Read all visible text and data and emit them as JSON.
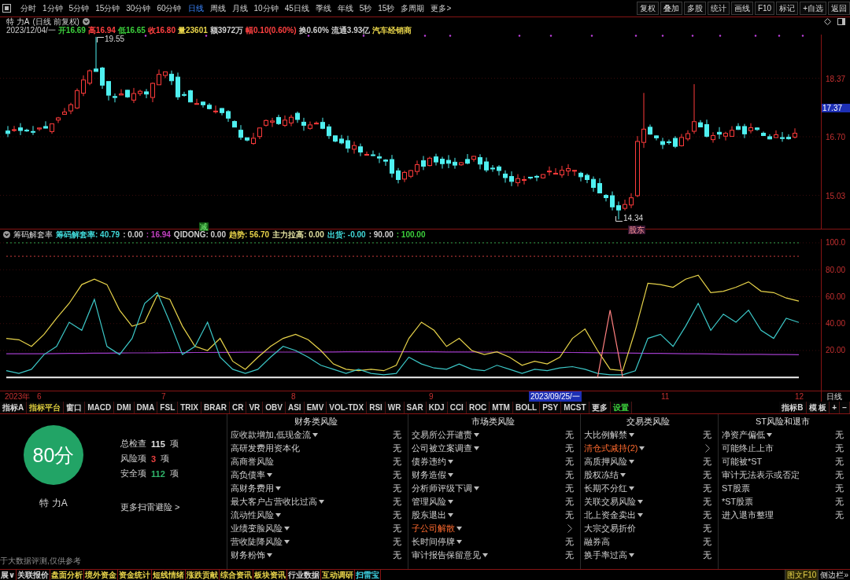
{
  "toolbar": {
    "periods": [
      {
        "label": "分时",
        "selected": false
      },
      {
        "label": "1分钟",
        "selected": false
      },
      {
        "label": "5分钟",
        "selected": false
      },
      {
        "label": "15分钟",
        "selected": false
      },
      {
        "label": "30分钟",
        "selected": false
      },
      {
        "label": "60分钟",
        "selected": false
      },
      {
        "label": "日线",
        "selected": true
      },
      {
        "label": "周线",
        "selected": false
      },
      {
        "label": "月线",
        "selected": false
      },
      {
        "label": "10分钟",
        "selected": false
      },
      {
        "label": "45日线",
        "selected": false
      },
      {
        "label": "季线",
        "selected": false
      },
      {
        "label": "年线",
        "selected": false
      },
      {
        "label": "5秒",
        "selected": false
      },
      {
        "label": "15秒",
        "selected": false
      },
      {
        "label": "多周期",
        "selected": false
      },
      {
        "label": "更多>",
        "selected": false
      }
    ],
    "actions": [
      "复权",
      "叠加",
      "多股",
      "统计",
      "画线",
      "F10",
      "标记",
      "+自选",
      "返回"
    ]
  },
  "chart_header": {
    "stock": "特 力A",
    "mode": "(日线 前复权)",
    "date": "2023/12/04/一",
    "quote": [
      {
        "text": "开16.69",
        "color": "#3ccf3c"
      },
      {
        "text": "高16.94",
        "color": "#ff4040"
      },
      {
        "text": "低16.65",
        "color": "#3ccf3c"
      },
      {
        "text": "收16.80",
        "color": "#ff4040"
      },
      {
        "text": "量23601",
        "color": "#e8d44a"
      },
      {
        "text": "额3972万",
        "color": "#d0d0d0"
      },
      {
        "text": "幅0.10(0.60%)",
        "color": "#ff4040"
      },
      {
        "text": "换0.60%",
        "color": "#d0d0d0"
      },
      {
        "text": "流通3.93亿",
        "color": "#d0d0d0"
      },
      {
        "text": "汽车经销商",
        "color": "#e8d44a"
      }
    ]
  },
  "price_chart": {
    "axis": [
      {
        "text": "18.37",
        "current": false
      },
      {
        "text": "17.37",
        "current": true
      },
      {
        "text": "16.70",
        "current": false
      },
      {
        "text": "15.03",
        "current": false
      }
    ],
    "high": "19.55",
    "low": "14.34",
    "signals": [
      {
        "text": "减",
        "kind": "reduce"
      },
      {
        "text": "股东",
        "kind": "holder"
      }
    ]
  },
  "indicator": {
    "name": "筹码解套率",
    "readouts": [
      {
        "text": "筹码解套率: 40.79",
        "color": "#40d8d8"
      },
      {
        "text": ": 0.00",
        "color": "#d0d0d0"
      },
      {
        "text": ": 16.94",
        "color": "#c040c0"
      },
      {
        "text": "QIDONG: 0.00",
        "color": "#d0d0d0"
      },
      {
        "text": "趋势: 56.70",
        "color": "#e8d44a"
      },
      {
        "text": "主力拉高: 0.00",
        "color": "#e0e0a0"
      },
      {
        "text": "出货: -0.00",
        "color": "#40d8d8"
      },
      {
        "text": ": 90.00",
        "color": "#d0d0d0"
      },
      {
        "text": ": 100.00",
        "color": "#3ccf3c"
      }
    ],
    "chart_data": {
      "type": "line",
      "grid": true,
      "ylim": [
        -9.8,
        102.9
      ],
      "yticks": [
        {
          "value": 20,
          "label": "20.00"
        },
        {
          "value": 40,
          "label": "40.00"
        },
        {
          "value": 60,
          "label": "60.00"
        },
        {
          "value": 80,
          "label": "80.00"
        },
        {
          "value": 100,
          "label": "100.0"
        }
      ],
      "ref_lines": [
        {
          "axis": "y",
          "value": 100,
          "color": "#2fa84f"
        },
        {
          "axis": "y",
          "value": 90,
          "color": "#c83c3c"
        }
      ],
      "series": [
        {
          "color": "#a03cc8",
          "values": [
            17.5,
            17.5,
            17.6,
            17.6,
            17.7,
            17.8,
            17.9,
            18,
            18,
            18.1,
            18.2,
            18.2,
            18.3,
            18.4,
            18.4,
            18.5,
            18.5,
            18.6,
            18.6,
            18.7,
            18.7,
            18.8,
            18.8,
            18.8,
            18.9,
            18.9,
            18.9,
            19,
            19,
            19,
            19,
            19,
            19,
            19,
            19,
            18.9,
            18.9,
            18.9,
            18.8,
            18.8,
            18.8,
            18.7,
            18.7,
            18.6,
            18.6,
            18.5,
            18.4,
            18.3,
            18.2,
            18.1,
            18,
            17.9,
            17.8,
            17.7,
            17.6,
            17.5,
            17.4,
            17.3,
            17.2,
            17.2,
            17.1,
            17,
            17,
            16.9
          ]
        },
        {
          "color": "#f0f0f0",
          "values": [
            0,
            0,
            0,
            0,
            0,
            0,
            0,
            0,
            0,
            0,
            0,
            0,
            0,
            0,
            0,
            0,
            0,
            0,
            0,
            0,
            0,
            0,
            0,
            0,
            0,
            0,
            0,
            0,
            0,
            0,
            0,
            0,
            0,
            0,
            0,
            0,
            0,
            0,
            0,
            0,
            0,
            0,
            0,
            0,
            0,
            0,
            0,
            0,
            0,
            0,
            0,
            0,
            0,
            0,
            0,
            0,
            0,
            0,
            0,
            0,
            0,
            0,
            0,
            0
          ]
        },
        {
          "color": "#e8d44a",
          "values": [
            29,
            28,
            23,
            32,
            44,
            55,
            69,
            73,
            69,
            50,
            38,
            41,
            61,
            58,
            38,
            23,
            20,
            29,
            12,
            6,
            15,
            23,
            29,
            32,
            28,
            20,
            10,
            6,
            5,
            6,
            5,
            9,
            29,
            41,
            35,
            23,
            29,
            20,
            17,
            19,
            15,
            9,
            12,
            10,
            15,
            29,
            36,
            20,
            6,
            5,
            35,
            70,
            69,
            67,
            73,
            76,
            63,
            64,
            67,
            71,
            64,
            63,
            59,
            56.7
          ]
        },
        {
          "color": "#3cc8c8",
          "values": [
            5,
            3,
            6,
            17,
            23,
            41,
            35,
            58,
            23,
            17,
            29,
            55,
            63,
            41,
            17,
            23,
            41,
            15,
            6,
            3,
            6,
            15,
            23,
            20,
            15,
            9,
            6,
            3,
            6,
            3,
            2,
            3,
            15,
            10,
            7,
            6,
            10,
            6,
            5,
            9,
            6,
            3,
            6,
            5,
            7,
            8,
            6,
            3,
            2,
            2,
            5,
            29,
            32,
            23,
            38,
            55,
            35,
            47,
            41,
            50,
            35,
            29,
            44,
            40.8
          ]
        },
        {
          "color": "#ff8080",
          "values": [
            null,
            null,
            null,
            null,
            null,
            null,
            null,
            null,
            null,
            null,
            null,
            null,
            null,
            null,
            null,
            null,
            null,
            null,
            null,
            null,
            null,
            null,
            null,
            null,
            null,
            null,
            null,
            null,
            null,
            null,
            null,
            null,
            null,
            null,
            null,
            null,
            null,
            null,
            null,
            null,
            null,
            null,
            null,
            null,
            null,
            null,
            null,
            0,
            50,
            0,
            null,
            null,
            null,
            null,
            null,
            null,
            null,
            null,
            null,
            null,
            null,
            null,
            null,
            null
          ]
        }
      ]
    }
  },
  "date_axis": {
    "labels": [
      {
        "text": "2023年",
        "kind": "year"
      },
      {
        "text": "6",
        "kind": "month"
      },
      {
        "text": "7",
        "kind": "month"
      },
      {
        "text": "8",
        "kind": "month"
      },
      {
        "text": "9",
        "kind": "month"
      },
      {
        "text": "2023/09/25/一",
        "kind": "cursor"
      },
      {
        "text": "11",
        "kind": "month"
      },
      {
        "text": "12",
        "kind": "month"
      }
    ],
    "period": "日线"
  },
  "indicator_tabs": {
    "left": [
      {
        "label": "指标A",
        "color": "#d8d8d8"
      },
      {
        "label": "指标平台",
        "color": "#d8c83c"
      },
      {
        "label": "窗口",
        "color": "#d8d8d8"
      },
      {
        "label": "MACD",
        "color": "#d8d8d8"
      },
      {
        "label": "DMI",
        "color": "#d8d8d8"
      },
      {
        "label": "DMA",
        "color": "#d8d8d8"
      },
      {
        "label": "FSL",
        "color": "#d8d8d8"
      },
      {
        "label": "TRIX",
        "color": "#d8d8d8"
      },
      {
        "label": "BRAR",
        "color": "#d8d8d8"
      },
      {
        "label": "CR",
        "color": "#d8d8d8"
      },
      {
        "label": "VR",
        "color": "#d8d8d8"
      },
      {
        "label": "OBV",
        "color": "#d8d8d8"
      },
      {
        "label": "ASI",
        "color": "#d8d8d8"
      },
      {
        "label": "EMV",
        "color": "#d8d8d8"
      },
      {
        "label": "VOL-TDX",
        "color": "#d8d8d8"
      },
      {
        "label": "RSI",
        "color": "#d8d8d8"
      },
      {
        "label": "WR",
        "color": "#d8d8d8"
      },
      {
        "label": "SAR",
        "color": "#d8d8d8"
      },
      {
        "label": "KDJ",
        "color": "#d8d8d8"
      },
      {
        "label": "CCI",
        "color": "#d8d8d8"
      },
      {
        "label": "ROC",
        "color": "#d8d8d8"
      },
      {
        "label": "MTM",
        "color": "#d8d8d8"
      },
      {
        "label": "BOLL",
        "color": "#d8d8d8"
      },
      {
        "label": "PSY",
        "color": "#d8d8d8"
      },
      {
        "label": "MCST",
        "color": "#d8d8d8"
      },
      {
        "label": "更多",
        "color": "#d8d8d8"
      },
      {
        "label": "设置",
        "color": "#3ccf3c"
      }
    ],
    "right": [
      "指标B",
      "模 板",
      "+",
      "−"
    ]
  },
  "risk_scan": {
    "score": "80分",
    "stock": "特 力A",
    "stats": [
      {
        "label": "总检查",
        "count": "115",
        "unit": "项",
        "color": "#e0e0e0"
      },
      {
        "label": "风险项",
        "count": "3",
        "unit": "项",
        "color": "#e84040"
      },
      {
        "label": "安全项",
        "count": "112",
        "unit": "项",
        "color": "#2fb46a"
      }
    ],
    "more_link": "更多扫雷避险 >",
    "footnote": "于大数据评测,仅供参考",
    "categories": [
      {
        "title": "财务类风险",
        "items": [
          {
            "label": "应收款增加,低现金流",
            "dropdown": true,
            "flagged": false,
            "result": "无"
          },
          {
            "label": "高研发费用资本化",
            "dropdown": false,
            "flagged": false,
            "result": "无"
          },
          {
            "label": "高商誉风险",
            "dropdown": false,
            "flagged": false,
            "result": "无"
          },
          {
            "label": "高负债率",
            "dropdown": true,
            "flagged": false,
            "result": "无"
          },
          {
            "label": "高财务费用",
            "dropdown": true,
            "flagged": false,
            "result": "无"
          },
          {
            "label": "最大客户占营收比过高",
            "dropdown": true,
            "flagged": false,
            "result": "无"
          },
          {
            "label": "流动性风险",
            "dropdown": true,
            "flagged": false,
            "result": "无"
          },
          {
            "label": "业绩变脸风险",
            "dropdown": true,
            "flagged": false,
            "result": "无"
          },
          {
            "label": "营收陡降风险",
            "dropdown": true,
            "flagged": false,
            "result": "无"
          },
          {
            "label": "财务粉饰",
            "dropdown": true,
            "flagged": false,
            "result": "无"
          }
        ]
      },
      {
        "title": "市场类风险",
        "items": [
          {
            "label": "交易所公开谴责",
            "dropdown": true,
            "flagged": false,
            "result": "无"
          },
          {
            "label": "公司被立案调查",
            "dropdown": true,
            "flagged": false,
            "result": "无"
          },
          {
            "label": "债券违约",
            "dropdown": true,
            "flagged": false,
            "result": "无"
          },
          {
            "label": "财务造假",
            "dropdown": true,
            "flagged": false,
            "result": "无"
          },
          {
            "label": "分析师评级下调",
            "dropdown": true,
            "flagged": false,
            "result": "无"
          },
          {
            "label": "管理风险",
            "dropdown": true,
            "flagged": false,
            "result": "无"
          },
          {
            "label": "股东退出",
            "dropdown": true,
            "flagged": false,
            "result": "无"
          },
          {
            "label": "子公司解散",
            "dropdown": true,
            "flagged": true
          },
          {
            "label": "长时间停牌",
            "dropdown": true,
            "flagged": false,
            "result": "无"
          },
          {
            "label": "审计报告保留意见",
            "dropdown": true,
            "flagged": false,
            "result": "无"
          }
        ]
      },
      {
        "title": "交易类风险",
        "items": [
          {
            "label": "大比例解禁",
            "dropdown": true,
            "flagged": false,
            "result": "无"
          },
          {
            "label": "清仓式减持(2)",
            "dropdown": true,
            "flagged": true
          },
          {
            "label": "高质押风险",
            "dropdown": true,
            "flagged": false,
            "result": "无"
          },
          {
            "label": "股权冻结",
            "dropdown": true,
            "flagged": false,
            "result": "无"
          },
          {
            "label": "长期不分红",
            "dropdown": true,
            "flagged": false,
            "result": "无"
          },
          {
            "label": "关联交易风险",
            "dropdown": true,
            "flagged": false,
            "result": "无"
          },
          {
            "label": "北上资金卖出",
            "dropdown": true,
            "flagged": false,
            "result": "无"
          },
          {
            "label": "大宗交易折价",
            "dropdown": false,
            "flagged": false,
            "result": "无"
          },
          {
            "label": "融券高",
            "dropdown": false,
            "flagged": false,
            "result": "无"
          },
          {
            "label": "换手率过高",
            "dropdown": true,
            "flagged": false,
            "result": "无"
          }
        ]
      },
      {
        "title": "ST风险和退市",
        "items": [
          {
            "label": "净资产偏低",
            "dropdown": true,
            "flagged": false,
            "result": "无"
          },
          {
            "label": "可能终止上市",
            "dropdown": false,
            "flagged": false,
            "result": "无"
          },
          {
            "label": "可能被*ST",
            "dropdown": false,
            "flagged": false,
            "result": "无"
          },
          {
            "label": "审计无法表示或否定",
            "dropdown": false,
            "flagged": false,
            "result": "无"
          },
          {
            "label": "ST股票",
            "dropdown": false,
            "flagged": false,
            "result": "无"
          },
          {
            "label": "*ST股票",
            "dropdown": false,
            "flagged": false,
            "result": "无"
          },
          {
            "label": "进入退市整理",
            "dropdown": false,
            "flagged": false,
            "result": "无"
          }
        ]
      }
    ]
  },
  "bottom_tabs": {
    "left": [
      {
        "label": "展∨",
        "color": "#d8d8d8"
      },
      {
        "label": "关联报价",
        "color": "#d8d8d8"
      },
      {
        "label": "盘面分析",
        "color": "#e8d44a"
      },
      {
        "label": "境外资金",
        "color": "#e8d44a"
      },
      {
        "label": "资金统计",
        "color": "#e8d44a"
      },
      {
        "label": "短线情绪",
        "color": "#e8d44a"
      },
      {
        "label": "涨跌贡献",
        "color": "#e8d44a"
      },
      {
        "label": "综合资讯",
        "color": "#e8d44a"
      },
      {
        "label": "板块资讯",
        "color": "#e8d44a"
      },
      {
        "label": "行业数据",
        "color": "#d8d8d8"
      },
      {
        "label": "互动调研",
        "color": "#e8d44a"
      },
      {
        "label": "扫雷宝",
        "color": "#40d8e8"
      }
    ],
    "right": [
      {
        "label": "图文F10",
        "kind": "highlight"
      },
      {
        "label": "侧边栏»",
        "kind": "plain"
      }
    ]
  }
}
